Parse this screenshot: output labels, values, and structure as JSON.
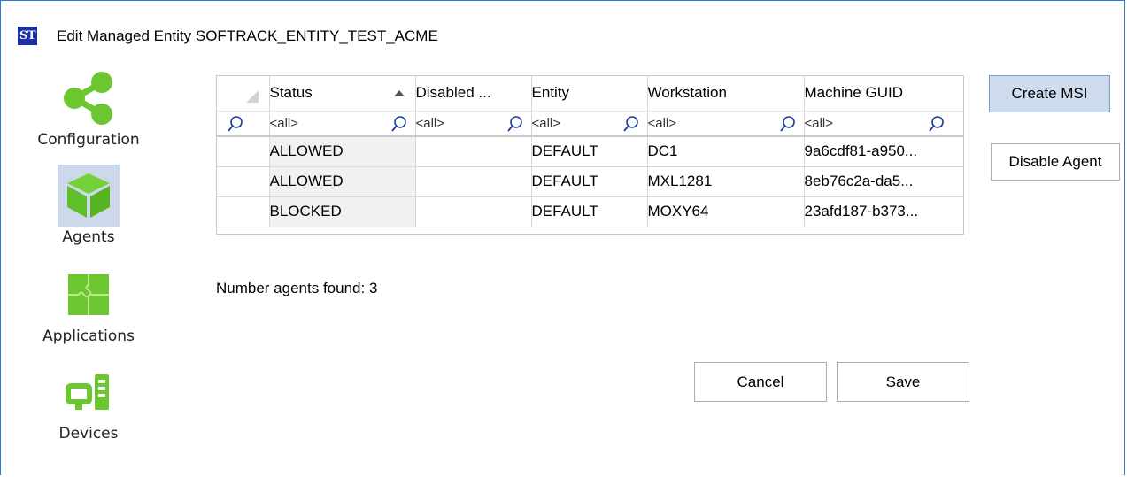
{
  "window": {
    "logo_text": "ST",
    "title": "Edit Managed Entity SOFTRACK_ENTITY_TEST_ACME"
  },
  "sidebar": {
    "items": [
      {
        "label": "Configuration",
        "icon": "share-icon",
        "selected": false
      },
      {
        "label": "Agents",
        "icon": "cube-icon",
        "selected": true
      },
      {
        "label": "Applications",
        "icon": "puzzle-icon",
        "selected": false
      },
      {
        "label": "Devices",
        "icon": "devices-icon",
        "selected": false
      }
    ],
    "accent_color": "#6cc62f",
    "selected_bg": "#ccd9ea"
  },
  "grid": {
    "columns": [
      {
        "label": "Status",
        "sorted": "ascending"
      },
      {
        "label": "Disabled ..."
      },
      {
        "label": "Entity"
      },
      {
        "label": "Workstation"
      },
      {
        "label": "Machine GUID"
      }
    ],
    "filter_placeholder": "<all>",
    "rows": [
      {
        "status": "ALLOWED",
        "disabled": "",
        "entity": "DEFAULT",
        "workstation": "DC1",
        "guid": "9a6cdf81-a950..."
      },
      {
        "status": "ALLOWED",
        "disabled": "",
        "entity": "DEFAULT",
        "workstation": "MXL1281",
        "guid": "8eb76c2a-da5..."
      },
      {
        "status": "BLOCKED",
        "disabled": "",
        "entity": "DEFAULT",
        "workstation": "MOXY64",
        "guid": "23afd187-b373..."
      }
    ]
  },
  "status_text": "Number agents found: 3",
  "buttons": {
    "create_msi": "Create MSI",
    "disable_agent": "Disable Agent",
    "cancel": "Cancel",
    "save": "Save"
  }
}
